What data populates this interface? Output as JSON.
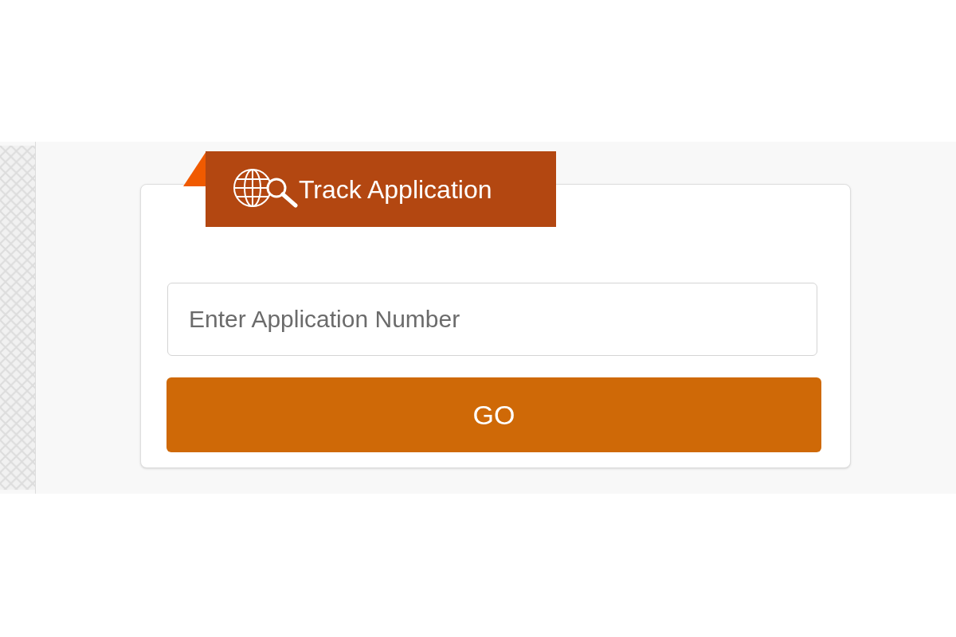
{
  "tab": {
    "title": "Track Application"
  },
  "search": {
    "placeholder": "Enter Application Number"
  },
  "button": {
    "label": "GO"
  }
}
